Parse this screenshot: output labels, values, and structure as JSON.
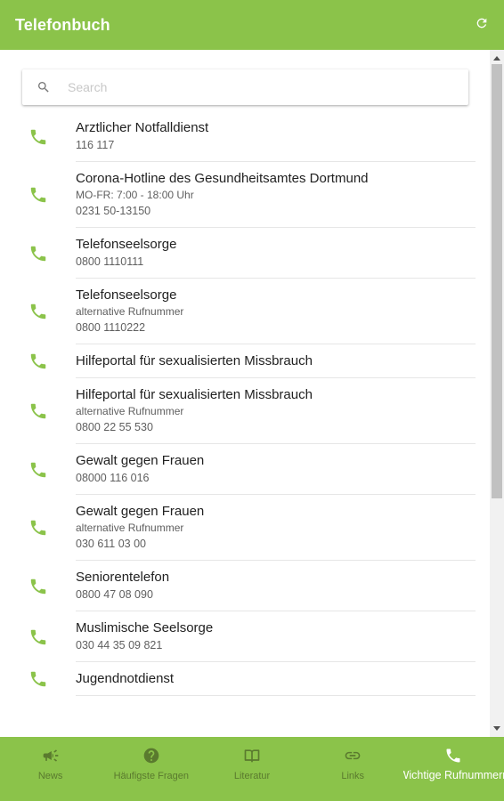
{
  "header": {
    "title": "Telefonbuch",
    "refresh_icon": "refresh-icon"
  },
  "colors": {
    "accent": "#8bc34a",
    "nav_inactive": "#5a7a2e",
    "phone_icon": "#8bc34a"
  },
  "search": {
    "placeholder": "Search",
    "value": ""
  },
  "contacts": [
    {
      "title": "Arztlicher Notfalldienst",
      "sub": "",
      "number": "116 117"
    },
    {
      "title": "Corona-Hotline des Gesundheitsamtes Dortmund",
      "sub": "MO-FR: 7:00 - 18:00 Uhr",
      "number": "0231 50-13150"
    },
    {
      "title": "Telefonseelsorge",
      "sub": "",
      "number": "0800 1110111"
    },
    {
      "title": "Telefonseelsorge",
      "sub": "alternative Rufnummer",
      "number": "0800 1110222"
    },
    {
      "title": "Hilfeportal für sexualisierten Missbrauch",
      "sub": "",
      "number": ""
    },
    {
      "title": "Hilfeportal für sexualisierten Missbrauch",
      "sub": "alternative Rufnummer",
      "number": "0800 22 55 530"
    },
    {
      "title": "Gewalt gegen Frauen",
      "sub": "",
      "number": "08000 116 016"
    },
    {
      "title": "Gewalt gegen Frauen",
      "sub": "alternative Rufnummer",
      "number": "030 611 03 00"
    },
    {
      "title": "Seniorentelefon",
      "sub": "",
      "number": "0800 47 08 090"
    },
    {
      "title": "Muslimische Seelsorge",
      "sub": "",
      "number": "030 44 35 09 821"
    },
    {
      "title": "Jugendnotdienst",
      "sub": "",
      "number": ""
    }
  ],
  "bottom_nav": [
    {
      "label": "News",
      "icon": "megaphone-icon",
      "active": false
    },
    {
      "label": "Häufigste Fragen",
      "icon": "help-circle-icon",
      "active": false
    },
    {
      "label": "Literatur",
      "icon": "book-icon",
      "active": false
    },
    {
      "label": "Links",
      "icon": "link-icon",
      "active": false
    },
    {
      "label": "Wichtige Rufnummern",
      "icon": "phone-icon",
      "active": true
    }
  ]
}
